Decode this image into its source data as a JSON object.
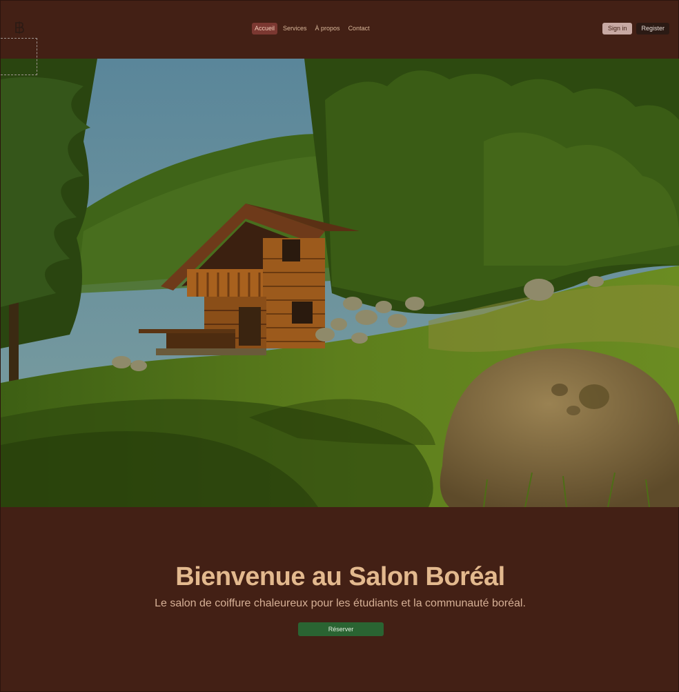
{
  "nav": {
    "items": [
      {
        "label": "Accueil",
        "active": true
      },
      {
        "label": "Services",
        "active": false
      },
      {
        "label": "À propos",
        "active": false
      },
      {
        "label": "Contact",
        "active": false
      }
    ]
  },
  "auth": {
    "signin_label": "Sign in",
    "register_label": "Register"
  },
  "hero": {
    "title": "Bienvenue au Salon Boréal",
    "subtitle": "Le salon de coiffure chaleureux pour les étudiants et la communauté boréal.",
    "cta_label": "Réserver"
  },
  "colors": {
    "background": "#432015",
    "accent_title": "#e3b98e",
    "nav_active_bg": "#7b3831",
    "cta_bg": "#2a6432"
  },
  "icons": {
    "logo": "boreal-logo-icon"
  }
}
